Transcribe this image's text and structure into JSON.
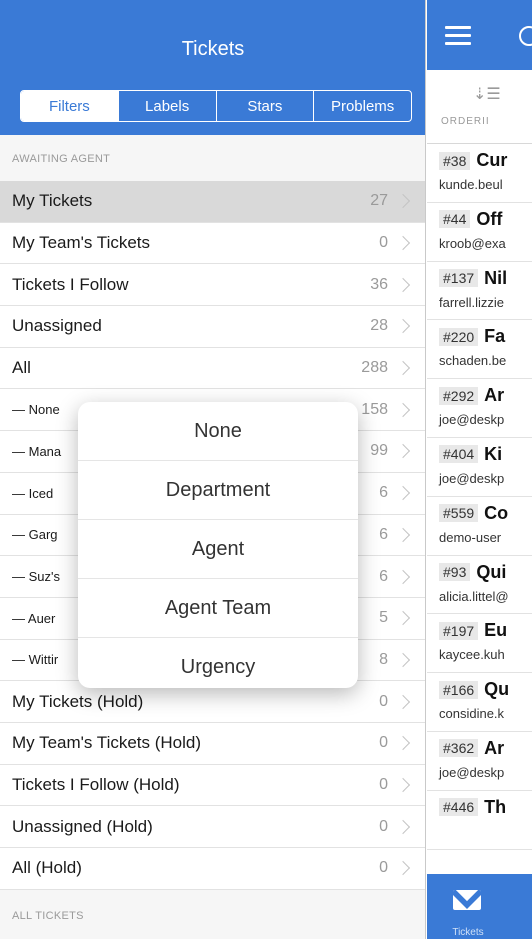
{
  "left_panel": {
    "title": "Tickets",
    "segments": [
      {
        "label": "Filters",
        "active": true
      },
      {
        "label": "Labels",
        "active": false
      },
      {
        "label": "Stars",
        "active": false
      },
      {
        "label": "Problems",
        "active": false
      }
    ],
    "section_awaiting": "AWAITING AGENT",
    "section_all": "ALL TICKETS",
    "rows": [
      {
        "label": "My Tickets",
        "count": "27",
        "selected": true,
        "sub": false
      },
      {
        "label": "My Team's Tickets",
        "count": "0",
        "sub": false
      },
      {
        "label": "Tickets I Follow",
        "count": "36",
        "sub": false
      },
      {
        "label": "Unassigned",
        "count": "28",
        "sub": false
      },
      {
        "label": "All",
        "count": "288",
        "sub": false
      },
      {
        "label": "— None",
        "count": "158",
        "sub": true
      },
      {
        "label": "— Mana",
        "count": "99",
        "sub": true
      },
      {
        "label": "— Iced",
        "count": "6",
        "sub": true
      },
      {
        "label": "— Garg",
        "count": "6",
        "sub": true
      },
      {
        "label": "— Suz's",
        "count": "6",
        "sub": true
      },
      {
        "label": "— Auer",
        "count": "5",
        "sub": true
      },
      {
        "label": "— Wittir",
        "count": "8",
        "sub": true
      },
      {
        "label": "My Tickets (Hold)",
        "count": "0",
        "sub": false
      },
      {
        "label": "My Team's Tickets (Hold)",
        "count": "0",
        "sub": false
      },
      {
        "label": "Tickets I Follow (Hold)",
        "count": "0",
        "sub": false
      },
      {
        "label": "Unassigned (Hold)",
        "count": "0",
        "sub": false
      },
      {
        "label": "All (Hold)",
        "count": "0",
        "sub": false
      }
    ]
  },
  "popover": {
    "items": [
      "None",
      "Department",
      "Agent",
      "Agent Team",
      "Urgency"
    ]
  },
  "right_panel": {
    "ordering_label": "ORDERII",
    "tickets": [
      {
        "id": "#38",
        "subject": "Cur",
        "email": "kunde.beul"
      },
      {
        "id": "#44",
        "subject": "Off",
        "email": "kroob@exa"
      },
      {
        "id": "#137",
        "subject": "Nil",
        "email": "farrell.lizzie"
      },
      {
        "id": "#220",
        "subject": "Fa",
        "email": "schaden.be"
      },
      {
        "id": "#292",
        "subject": "Ar",
        "email": "joe@deskp"
      },
      {
        "id": "#404",
        "subject": "Ki",
        "email": "joe@deskp"
      },
      {
        "id": "#559",
        "subject": "Co",
        "email": "demo-user"
      },
      {
        "id": "#93",
        "subject": "Qui",
        "email": "alicia.littel@"
      },
      {
        "id": "#197",
        "subject": "Eu",
        "email": "kaycee.kuh"
      },
      {
        "id": "#166",
        "subject": "Qu",
        "email": "considine.k"
      },
      {
        "id": "#362",
        "subject": "Ar",
        "email": "joe@deskp"
      },
      {
        "id": "#446",
        "subject": "Th",
        "email": ""
      }
    ],
    "tab_label": "Tickets"
  },
  "colors": {
    "accent": "#3a7ad6"
  }
}
